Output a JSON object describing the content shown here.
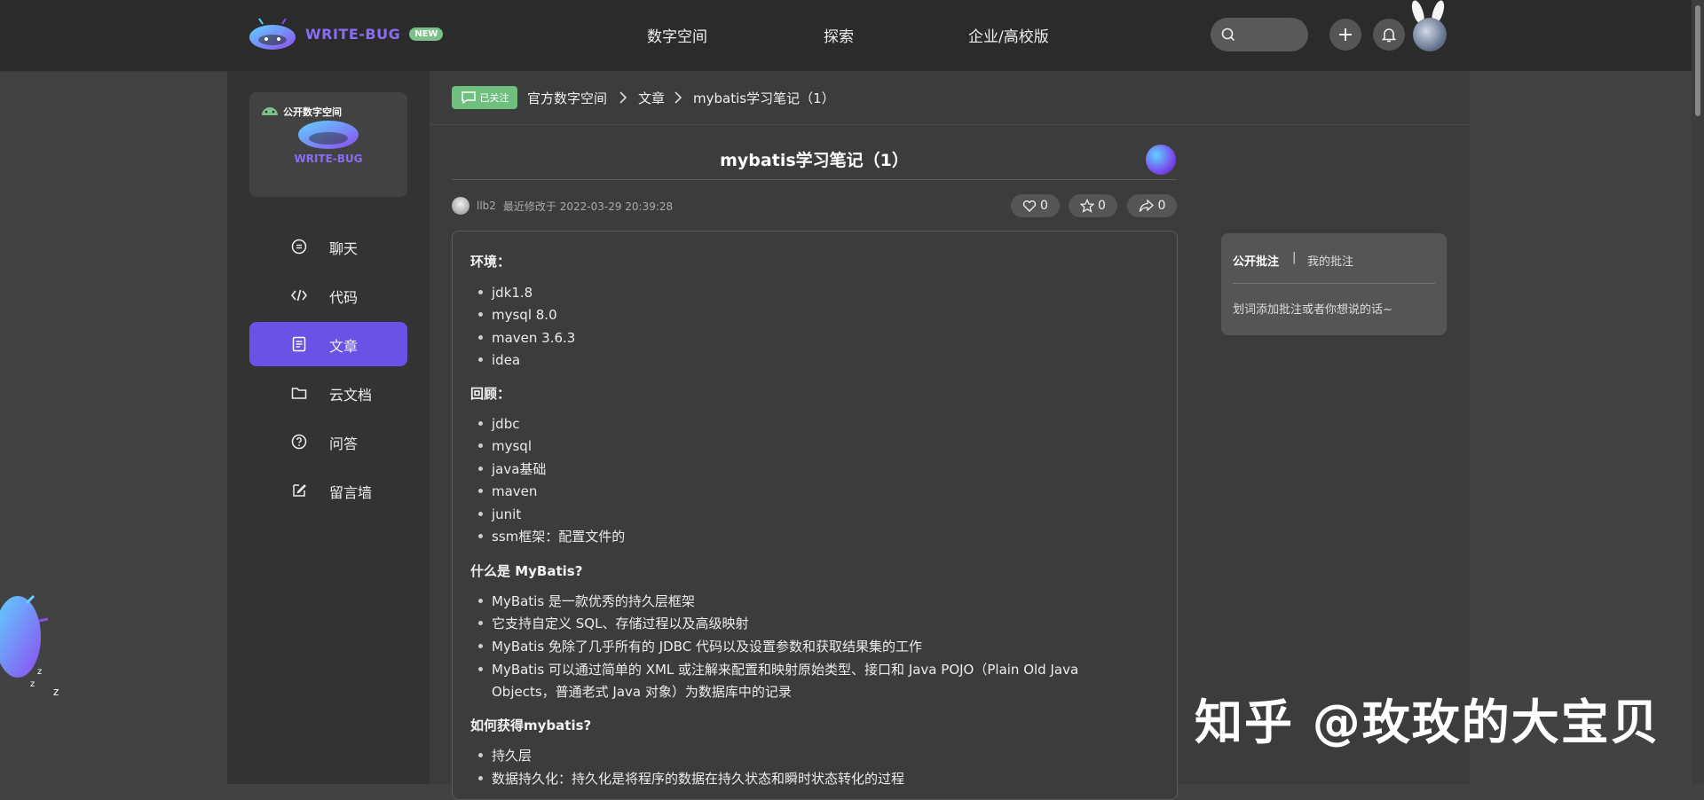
{
  "header": {
    "brand": "WRITE-BUG",
    "new_badge": "NEW",
    "nav": [
      "数字空间",
      "探索",
      "企业/高校版"
    ]
  },
  "sidebar": {
    "brand_tag": "公开数字空间",
    "brand_logo_text": "WRITE-BUG",
    "items": [
      {
        "label": "聊天",
        "icon": "chat-icon"
      },
      {
        "label": "代码",
        "icon": "code-icon"
      },
      {
        "label": "文章",
        "icon": "article-icon",
        "active": true
      },
      {
        "label": "云文档",
        "icon": "folder-icon"
      },
      {
        "label": "问答",
        "icon": "question-icon"
      },
      {
        "label": "留言墙",
        "icon": "edit-icon"
      }
    ]
  },
  "breadcrumb": {
    "follow_label": "已关注",
    "items": [
      "官方数字空间",
      "文章",
      "mybatis学习笔记（1）"
    ]
  },
  "article": {
    "title": "mybatis学习笔记（1）",
    "author": "llb2",
    "modified": "最近修改于 2022-03-29 20:39:28",
    "likes": "0",
    "stars": "0",
    "shares": "0",
    "sections": [
      {
        "heading": "环境：",
        "items": [
          "jdk1.8",
          "mysql 8.0",
          "maven 3.6.3",
          "idea"
        ]
      },
      {
        "heading": "回顾：",
        "items": [
          "jdbc",
          "mysql",
          "java基础",
          "maven",
          "junit",
          "ssm框架：配置文件的"
        ]
      },
      {
        "heading": "什么是 MyBatis?",
        "items": [
          "MyBatis 是一款优秀的持久层框架",
          "它支持自定义 SQL、存储过程以及高级映射",
          "MyBatis 免除了几乎所有的 JDBC 代码以及设置参数和获取结果集的工作",
          "MyBatis 可以通过简单的 XML 或注解来配置和映射原始类型、接口和 Java POJO（Plain Old Java",
          "Objects，普通老式 Java 对象）为数据库中的记录"
        ]
      },
      {
        "heading": "如何获得mybatis?",
        "items": [
          "持久层",
          "数据持久化：持久化是将程序的数据在持久状态和瞬时状态转化的过程"
        ]
      }
    ]
  },
  "annotations": {
    "tab_public": "公开批注",
    "separator": "|",
    "tab_mine": "我的批注",
    "placeholder": "划词添加批注或者你想说的话~"
  },
  "watermark": "知乎 @玫玫的大宝贝",
  "mascot_sleep": [
    "z",
    "z",
    "z"
  ],
  "colors": {
    "accent": "#6b52e6",
    "follow_green": "#6fbf7e",
    "brand": "#8b6cf6"
  }
}
